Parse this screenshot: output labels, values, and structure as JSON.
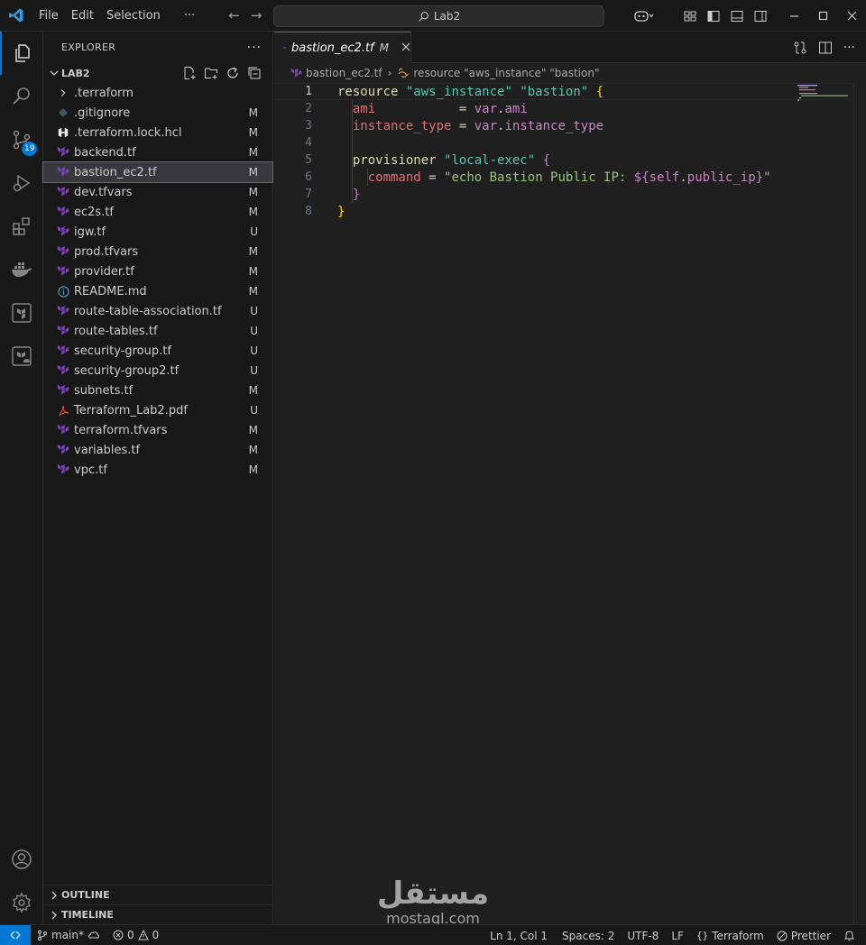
{
  "titlebar": {
    "menu": [
      "File",
      "Edit",
      "Selection",
      "···"
    ],
    "search": "Lab2"
  },
  "activity": {
    "scm_badge": "19"
  },
  "explorer": {
    "title": "EXPLORER",
    "folder": "LAB2",
    "files": [
      {
        "name": ".terraform",
        "status": "",
        "icon": "chevron-right-icon"
      },
      {
        "name": ".gitignore",
        "status": "M",
        "icon": "git-file-icon"
      },
      {
        "name": ".terraform.lock.hcl",
        "status": "M",
        "icon": "hcl-icon"
      },
      {
        "name": "backend.tf",
        "status": "M",
        "icon": "terraform-file-icon"
      },
      {
        "name": "bastion_ec2.tf",
        "status": "M",
        "icon": "terraform-file-icon"
      },
      {
        "name": "dev.tfvars",
        "status": "M",
        "icon": "terraform-file-icon"
      },
      {
        "name": "ec2s.tf",
        "status": "M",
        "icon": "terraform-file-icon"
      },
      {
        "name": "igw.tf",
        "status": "U",
        "icon": "terraform-file-icon"
      },
      {
        "name": "prod.tfvars",
        "status": "M",
        "icon": "terraform-file-icon"
      },
      {
        "name": "provider.tf",
        "status": "M",
        "icon": "terraform-file-icon"
      },
      {
        "name": "README.md",
        "status": "M",
        "icon": "info-icon"
      },
      {
        "name": "route-table-association.tf",
        "status": "U",
        "icon": "terraform-file-icon"
      },
      {
        "name": "route-tables.tf",
        "status": "U",
        "icon": "terraform-file-icon"
      },
      {
        "name": "security-group.tf",
        "status": "U",
        "icon": "terraform-file-icon"
      },
      {
        "name": "security-group2.tf",
        "status": "U",
        "icon": "terraform-file-icon"
      },
      {
        "name": "subnets.tf",
        "status": "M",
        "icon": "terraform-file-icon"
      },
      {
        "name": "Terraform_Lab2.pdf",
        "status": "U",
        "icon": "pdf-icon"
      },
      {
        "name": "terraform.tfvars",
        "status": "M",
        "icon": "terraform-file-icon"
      },
      {
        "name": "variables.tf",
        "status": "M",
        "icon": "terraform-file-icon"
      },
      {
        "name": "vpc.tf",
        "status": "M",
        "icon": "terraform-file-icon"
      }
    ],
    "outline": "OUTLINE",
    "timeline": "TIMELINE"
  },
  "editor": {
    "tab_name": "bastion_ec2.tf",
    "tab_modified": "M",
    "breadcrumb_file": "bastion_ec2.tf",
    "breadcrumb_symbol": "resource \"aws_instance\" \"bastion\"",
    "line_numbers": [
      "1",
      "2",
      "3",
      "4",
      "5",
      "6",
      "7",
      "8"
    ]
  },
  "statusbar": {
    "branch": "main*",
    "errors": "0",
    "warnings": "0",
    "position": "Ln 1, Col 1",
    "spaces": "Spaces: 2",
    "encoding": "UTF-8",
    "eol": "LF",
    "language": "Terraform",
    "formatter": "Prettier"
  },
  "watermark": {
    "arabic": "مستقل",
    "latin": "mostaql.com"
  },
  "colors": {
    "accent": "#0078d4",
    "terraform": "#7b42bc"
  }
}
